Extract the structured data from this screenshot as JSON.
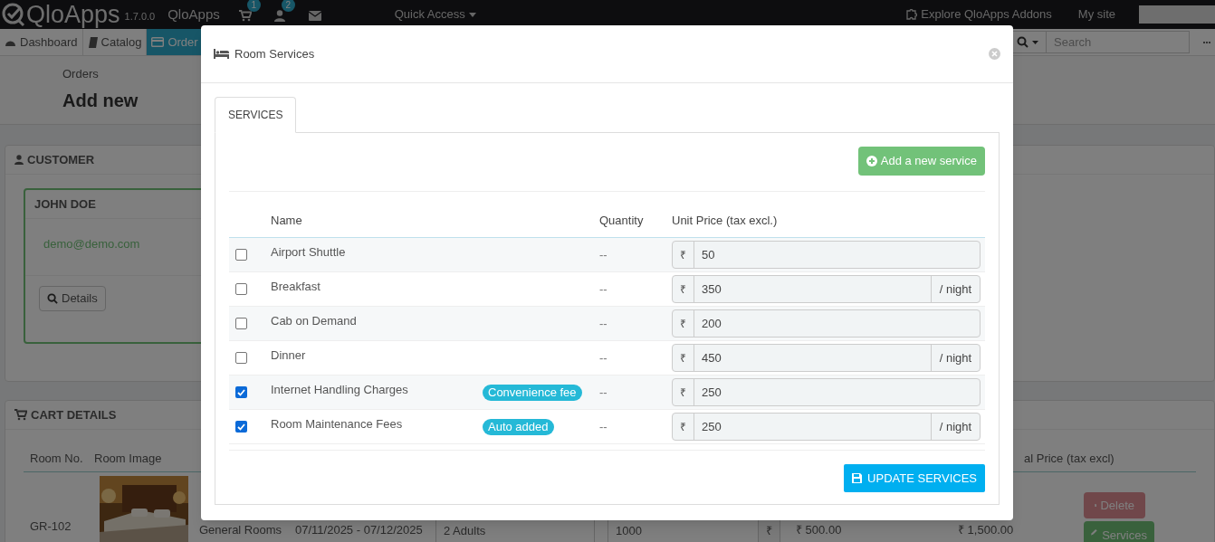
{
  "topbar": {
    "logo": "QloApps",
    "version": "1.7.0.0",
    "shop": "QloApps",
    "cart_count": "1",
    "customer_count": "2",
    "quick_access": "Quick Access",
    "addons": "Explore QloApps Addons",
    "my_site": "My site"
  },
  "nav": [
    {
      "label": "Dashboard",
      "selected": false
    },
    {
      "label": "Catalog",
      "selected": false
    },
    {
      "label": "Order",
      "selected": true
    }
  ],
  "search": {
    "placeholder": "Search"
  },
  "breadcrumb": "Orders",
  "page_title": "Add new",
  "customer_panel": {
    "title": "CUSTOMER",
    "name": "JOHN DOE",
    "email": "demo@demo.com",
    "details_button": "Details"
  },
  "cart_panel": {
    "title": "CART DETAILS",
    "columns": [
      "Room No.",
      "Room Image",
      "al Price (tax excl)"
    ],
    "row": {
      "room_no": "GR-102",
      "room_type": "General Rooms",
      "dates": "07/11/2025 - 07/12/2025",
      "occupancy": "2 Adults",
      "price": "1000",
      "currency": "₹",
      "unit_price": "₹ 500.00",
      "total": "₹ 1,500.00"
    },
    "buttons": [
      {
        "kind": "delete",
        "label": "Delete"
      },
      {
        "kind": "services",
        "label": "Services"
      }
    ]
  },
  "modal": {
    "title": "Room Services",
    "tabs": [
      {
        "label": "SERVICES",
        "selected": true
      }
    ],
    "add_button": "Add a new service",
    "columns": [
      "Name",
      "Quantity",
      "Unit Price (tax excl.)"
    ],
    "rows": [
      {
        "checked": false,
        "name": "Airport Shuttle",
        "quantity": "--",
        "currency": "₹",
        "price": "50"
      },
      {
        "checked": false,
        "name": "Breakfast",
        "quantity": "--",
        "currency": "₹",
        "price": "350",
        "suffix": "/ night"
      },
      {
        "checked": false,
        "name": "Cab on Demand",
        "quantity": "--",
        "currency": "₹",
        "price": "200"
      },
      {
        "checked": false,
        "name": "Dinner",
        "quantity": "--",
        "currency": "₹",
        "price": "450",
        "suffix": "/ night"
      },
      {
        "checked": true,
        "name": "Internet Handling Charges",
        "badge": "Convenience fee",
        "quantity": "--",
        "currency": "₹",
        "price": "250"
      },
      {
        "checked": true,
        "name": "Room Maintenance Fees",
        "badge": "Auto added",
        "quantity": "--",
        "currency": "₹",
        "price": "250",
        "suffix": "/ night"
      }
    ],
    "update_button": "UPDATE SERVICES"
  }
}
